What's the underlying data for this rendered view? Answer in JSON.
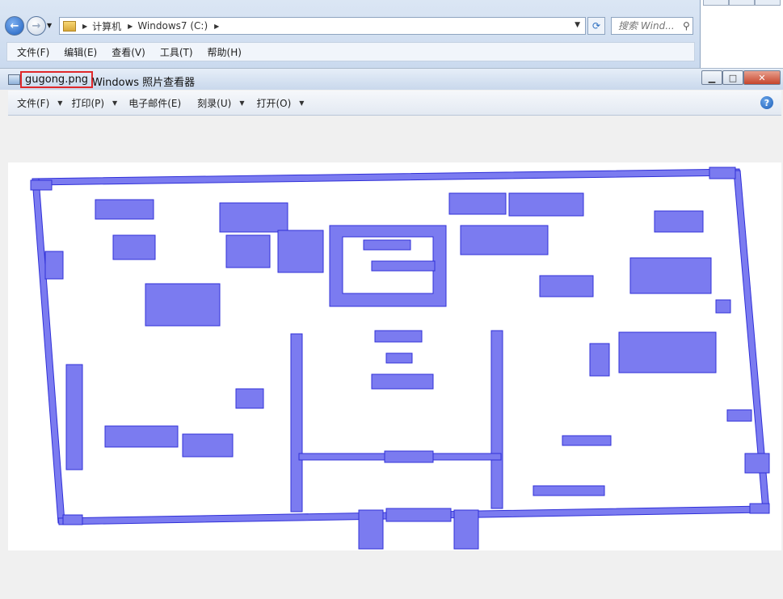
{
  "explorer": {
    "breadcrumb": [
      "计算机",
      "Windows7 (C:)"
    ],
    "search_placeholder": "搜索 Wind...",
    "menu": [
      "文件(F)",
      "编辑(E)",
      "查看(V)",
      "工具(T)",
      "帮助(H)"
    ]
  },
  "viewer": {
    "file_name": "gugong.png",
    "app_name": "Windows 照片查看器",
    "toolbar": [
      {
        "label": "文件(F)",
        "has_dropdown": true
      },
      {
        "label": "打印(P)",
        "has_dropdown": true
      },
      {
        "label": "电子邮件(E)",
        "has_dropdown": false
      },
      {
        "label": "刻录(U)",
        "has_dropdown": true
      },
      {
        "label": "打开(O)",
        "has_dropdown": true
      }
    ],
    "help_icon": "?",
    "accent_color": "#6666ee",
    "highlight_color": "#e0282a"
  },
  "icons": [
    "back-arrow-icon",
    "forward-arrow-icon",
    "folder-icon",
    "refresh-icon",
    "search-icon",
    "help-icon",
    "minimize-icon",
    "maximize-icon",
    "close-icon"
  ]
}
